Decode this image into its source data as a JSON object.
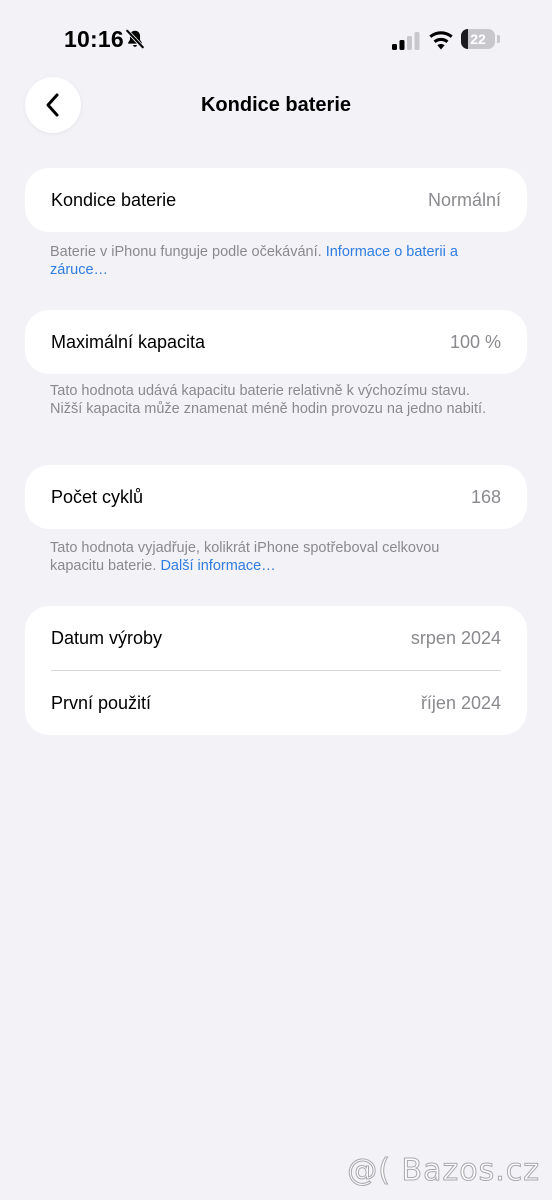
{
  "status_bar": {
    "time": "10:16",
    "battery_level": "22",
    "battery_fraction": 0.22,
    "icons": [
      "bell-slash-icon",
      "signal-icon",
      "wifi-icon",
      "battery-icon"
    ]
  },
  "nav": {
    "title": "Kondice baterie",
    "back_icon": "chevron-left-icon"
  },
  "health": {
    "label": "Kondice baterie",
    "value": "Normální",
    "footnote_text": "Baterie v iPhonu funguje podle očekávání. ",
    "footnote_link": "Informace o baterii a záruce…"
  },
  "capacity": {
    "label": "Maximální kapacita",
    "value": "100 %",
    "footnote_text": "Tato hodnota udává kapacitu baterie relativně k výchozímu stavu. Nižší kapacita může znamenat méně hodin provozu na jedno nabití."
  },
  "cycles": {
    "label": "Počet cyklů",
    "value": "168",
    "footnote_text": "Tato hodnota vyjadřuje, kolikrát iPhone spotřeboval celkovou kapacitu baterie. ",
    "footnote_link": "Další informace…"
  },
  "dates": {
    "manufacture_label": "Datum výroby",
    "manufacture_value": "srpen 2024",
    "first_use_label": "První použití",
    "first_use_value": "říjen 2024"
  },
  "watermark": "@( Bazos.cz",
  "colors": {
    "background": "#f2f2f7",
    "card": "#ffffff",
    "secondary_text": "#8a8a8e",
    "link": "#2f7de1"
  }
}
